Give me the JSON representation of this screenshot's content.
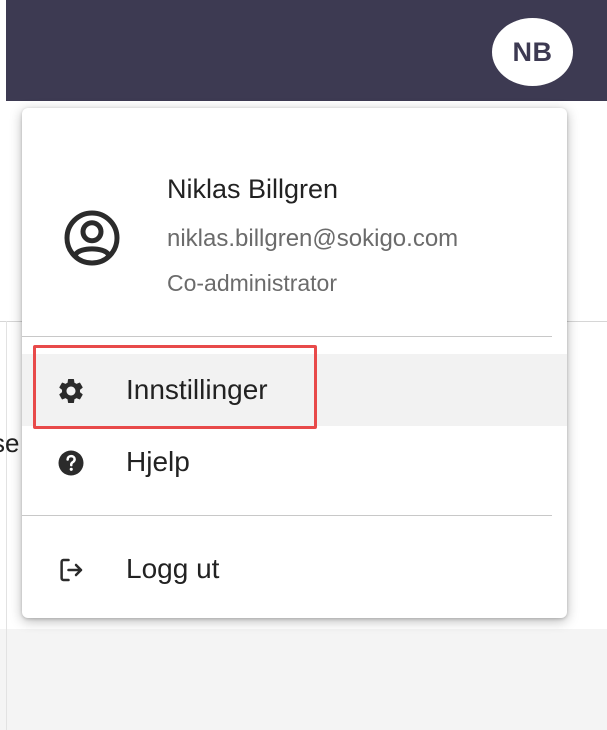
{
  "header": {
    "avatar_initials": "NB",
    "bar_color": "#3d3a52"
  },
  "background": {
    "text_fragment": "se"
  },
  "user_menu": {
    "user": {
      "icon": "account-circle-icon",
      "name": "Niklas Billgren",
      "email": "niklas.billgren@sokigo.com",
      "role": "Co-administrator"
    },
    "items": [
      {
        "icon": "gear-icon",
        "label": "Innstillinger",
        "highlighted": true
      },
      {
        "icon": "help-circle-icon",
        "label": "Hjelp",
        "highlighted": false
      },
      {
        "icon": "logout-icon",
        "label": "Logg ut",
        "highlighted": false
      }
    ],
    "highlight_color": "#e84a4a"
  }
}
